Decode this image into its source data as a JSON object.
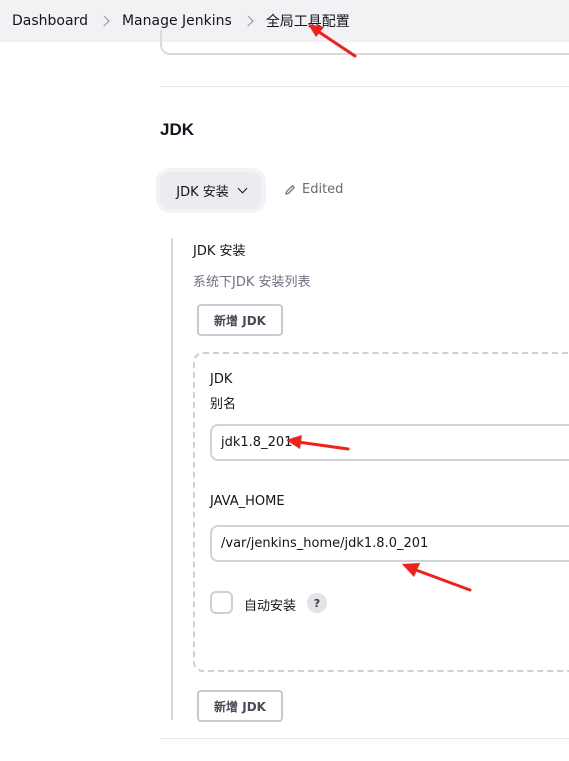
{
  "breadcrumb": {
    "items": [
      "Dashboard",
      "Manage Jenkins",
      "全局工具配置"
    ]
  },
  "section": {
    "title": "JDK"
  },
  "dropdown": {
    "label": "JDK 安装"
  },
  "edited": {
    "label": "Edited"
  },
  "jdk_installations": {
    "label": "JDK 安装",
    "description": "系统下JDK 安装列表",
    "add_button_top": "新增 JDK",
    "add_button_bottom": "新增 JDK"
  },
  "jdk_entry": {
    "heading": "JDK",
    "alias_label": "别名",
    "alias_value": "jdk1.8_201",
    "java_home_label": "JAVA_HOME",
    "java_home_value": "/var/jenkins_home/jdk1.8.0_201",
    "auto_install_label": "自动安装",
    "help_label": "?"
  },
  "colors": {
    "annotation_arrow": "#f0211a",
    "breadcrumb_bg": "#f2f2f4",
    "muted_text": "#707084"
  }
}
